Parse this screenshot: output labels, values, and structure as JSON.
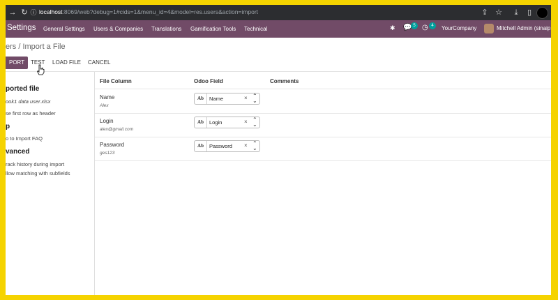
{
  "browser": {
    "url_host": "localhost",
    "url_rest": ":8069/web?debug=1#cids=1&menu_id=4&model=res.users&action=import"
  },
  "navbar": {
    "app_name": "Settings",
    "menu": [
      "General Settings",
      "Users & Companies",
      "Translations",
      "Gamification Tools",
      "Technical"
    ],
    "messages_badge": "5",
    "activities_badge": "4",
    "company": "YourCompany",
    "user": "Mitchell Admin (sinaip"
  },
  "breadcrumb": "ers / Import a File",
  "toolbar": {
    "import_label": "PORT",
    "test_label": "TEST",
    "load_file_label": "LOAD FILE",
    "cancel_label": "CANCEL"
  },
  "sidebar": {
    "imported_file_heading": "ported file",
    "file_name": "ook1 data user.xlsx",
    "header_option": "se first row as header",
    "help_heading": "p",
    "faq_link": "o to Import FAQ",
    "advanced_heading": "vanced",
    "track_history": "rack history during import",
    "allow_matching": "llow matching with subfields"
  },
  "table": {
    "headers": {
      "file_column": "File Column",
      "odoo_field": "Odoo Field",
      "comments": "Comments"
    },
    "rows": [
      {
        "column": "Name",
        "sample": "Alex",
        "field": "Name"
      },
      {
        "column": "Login",
        "sample": "alex@gmail.com",
        "field": "Login"
      },
      {
        "column": "Password",
        "sample": "ges123",
        "field": "Password"
      }
    ],
    "field_type_icon": "Ab"
  },
  "colors": {
    "odoo_purple": "#714b67",
    "badge_teal": "#00a09d",
    "frame_yellow": "#f5d300"
  }
}
